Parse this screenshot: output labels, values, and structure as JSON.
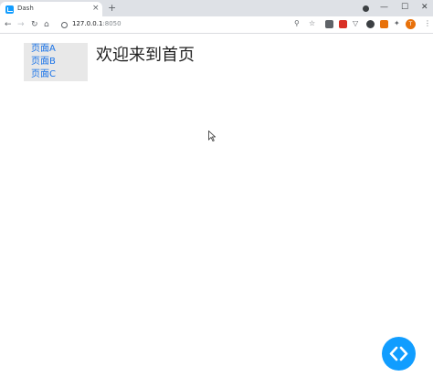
{
  "browser": {
    "tab_title": "Dash",
    "tab_close": "×",
    "new_tab": "+",
    "window_minimize": "—",
    "window_maximize": "☐",
    "window_close": "✕",
    "url_host": "127.0.0.1",
    "url_port": ":8050",
    "avatar_letter": "T"
  },
  "sidebar": {
    "items": [
      {
        "label": "页面A"
      },
      {
        "label": "页面B"
      },
      {
        "label": "页面C"
      }
    ]
  },
  "main": {
    "heading": "欢迎来到首页"
  },
  "icons": {
    "favicon": "dash-logo-icon",
    "devtools": "code-brackets-icon"
  },
  "colors": {
    "link": "#1a73e8",
    "dash_blue": "#119dff",
    "sidebar_bg": "#e8e8e8"
  }
}
